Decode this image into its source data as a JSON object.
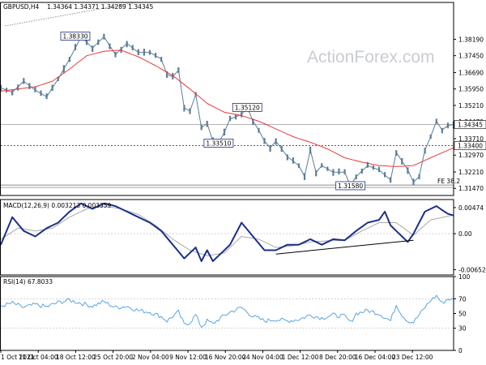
{
  "window": {
    "symbol_label": "GBPUSD,H4",
    "ohlc_label": "1.34364 1.34371 1.34289 1.34345",
    "watermark": "ActionForex.com"
  },
  "colors": {
    "price": "#5c7d96",
    "ma": "#e8393a",
    "macd": "#1c2f8c",
    "signal": "#a9a9a9",
    "rsi": "#4a9be0",
    "frame": "#000000",
    "grid": "#d9d9d9",
    "label_border": "#1c2f8c"
  },
  "chart_data": [
    {
      "type": "line",
      "panel": "price",
      "ylim": [
        1.3115,
        1.3985
      ],
      "y_ticks": [
        "1.38190",
        "1.37450",
        "1.36690",
        "1.35950",
        "1.35210",
        "1.34470",
        "1.33710",
        "1.32970",
        "1.32210",
        "1.31470"
      ],
      "y_tick_values": [
        1.3819,
        1.3745,
        1.3669,
        1.3595,
        1.3521,
        1.3447,
        1.3371,
        1.3297,
        1.3221,
        1.3147
      ],
      "current_price_label": "1.34345",
      "current_price": 1.34345,
      "level_label": "1.33400",
      "level": 1.334,
      "x_labels": [
        "1 Oct 2021",
        "11 Oct 04:00",
        "18 Oct 12:00",
        "25 Oct 20:00",
        "2 Nov 04:00",
        "9 Nov 12:00",
        "16 Nov 20:00",
        "24 Nov 04:00",
        "1 Dec 12:00",
        "8 Dec 20:00",
        "16 Dec 04:00",
        "23 Dec 12:00"
      ],
      "price_anchors": [
        [
          0,
          1.36
        ],
        [
          2,
          1.358
        ],
        [
          4,
          1.363
        ],
        [
          6,
          1.359
        ],
        [
          8,
          1.356
        ],
        [
          10,
          1.364
        ],
        [
          12,
          1.373
        ],
        [
          14,
          1.383
        ],
        [
          16,
          1.378
        ],
        [
          18,
          1.383
        ],
        [
          20,
          1.375
        ],
        [
          22,
          1.38
        ],
        [
          24,
          1.376
        ],
        [
          26,
          1.376
        ],
        [
          28,
          1.373
        ],
        [
          29,
          1.366
        ],
        [
          30,
          1.365
        ],
        [
          31,
          1.368
        ],
        [
          32,
          1.351
        ],
        [
          33,
          1.3495
        ],
        [
          34,
          1.357
        ],
        [
          35,
          1.342
        ],
        [
          36,
          1.344
        ],
        [
          37,
          1.336
        ],
        [
          38,
          1.3351
        ],
        [
          39,
          1.34
        ],
        [
          40,
          1.346
        ],
        [
          41,
          1.347
        ],
        [
          42,
          1.348
        ],
        [
          43,
          1.3512
        ],
        [
          44,
          1.345
        ],
        [
          45,
          1.341
        ],
        [
          46,
          1.336
        ],
        [
          47,
          1.333
        ],
        [
          48,
          1.336
        ],
        [
          50,
          1.329
        ],
        [
          52,
          1.325
        ],
        [
          53,
          1.32
        ],
        [
          54,
          1.332
        ],
        [
          55,
          1.3218
        ],
        [
          56,
          1.325
        ],
        [
          58,
          1.322
        ],
        [
          60,
          1.322
        ],
        [
          61,
          1.3159
        ],
        [
          62,
          1.32
        ],
        [
          64,
          1.325
        ],
        [
          66,
          1.323
        ],
        [
          68,
          1.3185
        ],
        [
          69,
          1.331
        ],
        [
          70,
          1.327
        ],
        [
          71,
          1.323
        ],
        [
          72,
          1.3175
        ],
        [
          73,
          1.32
        ],
        [
          74,
          1.332
        ],
        [
          75,
          1.338
        ],
        [
          76,
          1.345
        ],
        [
          77,
          1.341
        ],
        [
          78,
          1.343
        ],
        [
          79,
          1.3435
        ]
      ],
      "ma_anchors": [
        [
          0,
          1.3585
        ],
        [
          3,
          1.3595
        ],
        [
          6,
          1.3605
        ],
        [
          9,
          1.363
        ],
        [
          12,
          1.3685
        ],
        [
          15,
          1.3745
        ],
        [
          18,
          1.3765
        ],
        [
          21,
          1.377
        ],
        [
          24,
          1.374
        ],
        [
          27,
          1.37
        ],
        [
          30,
          1.3655
        ],
        [
          33,
          1.3595
        ],
        [
          36,
          1.353
        ],
        [
          39,
          1.349
        ],
        [
          42,
          1.3475
        ],
        [
          45,
          1.345
        ],
        [
          48,
          1.3415
        ],
        [
          51,
          1.338
        ],
        [
          54,
          1.3355
        ],
        [
          57,
          1.3325
        ],
        [
          60,
          1.3285
        ],
        [
          63,
          1.3265
        ],
        [
          66,
          1.325
        ],
        [
          69,
          1.3245
        ],
        [
          72,
          1.325
        ],
        [
          75,
          1.3285
        ],
        [
          79,
          1.333
        ]
      ],
      "annotations": [
        {
          "text": "1.38330",
          "price": 1.3833,
          "idx": 13
        },
        {
          "text": "1.35120",
          "price": 1.3512,
          "idx": 43
        },
        {
          "text": "1.33510",
          "price": 1.3351,
          "idx": 38
        },
        {
          "text": "1.31580",
          "price": 1.3159,
          "idx": 61
        }
      ],
      "fe_label": "FE 38.2",
      "fe_level": 1.3162
    },
    {
      "type": "line",
      "panel": "macd",
      "title": "MACD(12,26,9) 0.003213 0.003359",
      "ylim": [
        -0.0075,
        0.0062
      ],
      "y_ticks": [
        "0.00474",
        "0.00",
        "-0.006526"
      ],
      "y_tick_values": [
        0.00474,
        0.0,
        -0.006526
      ],
      "macd_anchors": [
        [
          0,
          -0.002
        ],
        [
          2,
          0.003
        ],
        [
          4,
          0.0005
        ],
        [
          6,
          -0.0005
        ],
        [
          8,
          0.001
        ],
        [
          10,
          0.002
        ],
        [
          12,
          0.004
        ],
        [
          14,
          0.0055
        ],
        [
          16,
          0.0045
        ],
        [
          18,
          0.0055
        ],
        [
          20,
          0.005
        ],
        [
          22,
          0.004
        ],
        [
          24,
          0.003
        ],
        [
          26,
          0.002
        ],
        [
          28,
          0.0005
        ],
        [
          30,
          -0.002
        ],
        [
          32,
          -0.0045
        ],
        [
          34,
          -0.0025
        ],
        [
          35,
          -0.005
        ],
        [
          36,
          -0.003
        ],
        [
          37,
          -0.005
        ],
        [
          38,
          -0.004
        ],
        [
          40,
          -0.002
        ],
        [
          42,
          0.002
        ],
        [
          44,
          -0.0005
        ],
        [
          46,
          -0.003
        ],
        [
          48,
          -0.003
        ],
        [
          50,
          -0.002
        ],
        [
          52,
          -0.002
        ],
        [
          54,
          -0.001
        ],
        [
          56,
          -0.002
        ],
        [
          58,
          -0.001
        ],
        [
          60,
          -0.0012
        ],
        [
          62,
          0.0005
        ],
        [
          64,
          0.002
        ],
        [
          66,
          0.0025
        ],
        [
          67,
          0.004
        ],
        [
          68,
          0.0015
        ],
        [
          70,
          -0.0005
        ],
        [
          71,
          -0.0015
        ],
        [
          72,
          0.0
        ],
        [
          74,
          0.004
        ],
        [
          76,
          0.005
        ],
        [
          78,
          0.0036
        ],
        [
          79,
          0.0033
        ]
      ],
      "signal_anchors": [
        [
          0,
          -0.001
        ],
        [
          3,
          0.001
        ],
        [
          6,
          0.0005
        ],
        [
          9,
          0.001
        ],
        [
          12,
          0.003
        ],
        [
          15,
          0.0045
        ],
        [
          18,
          0.005
        ],
        [
          21,
          0.0045
        ],
        [
          24,
          0.0035
        ],
        [
          27,
          0.0015
        ],
        [
          30,
          -0.001
        ],
        [
          33,
          -0.003
        ],
        [
          36,
          -0.004
        ],
        [
          39,
          -0.0035
        ],
        [
          42,
          -0.0005
        ],
        [
          45,
          -0.001
        ],
        [
          48,
          -0.0025
        ],
        [
          51,
          -0.0022
        ],
        [
          54,
          -0.0015
        ],
        [
          57,
          -0.0013
        ],
        [
          60,
          -0.0012
        ],
        [
          63,
          0.0005
        ],
        [
          66,
          0.002
        ],
        [
          69,
          0.002
        ],
        [
          72,
          -0.0003
        ],
        [
          75,
          0.0025
        ],
        [
          79,
          0.0034
        ]
      ],
      "trendline": [
        [
          48,
          -0.0037
        ],
        [
          72,
          -0.0012
        ]
      ]
    },
    {
      "type": "line",
      "panel": "rsi",
      "title": "RSI(14) 67.8033",
      "ylim": [
        0,
        100
      ],
      "y_ticks": [
        "100",
        "70",
        "50",
        "30",
        "0"
      ],
      "y_tick_values": [
        100,
        70,
        50,
        30,
        0
      ],
      "levels": [
        70,
        30
      ],
      "rsi_anchors": [
        [
          0,
          60
        ],
        [
          2,
          64
        ],
        [
          4,
          58
        ],
        [
          6,
          62
        ],
        [
          8,
          59
        ],
        [
          10,
          65
        ],
        [
          12,
          68
        ],
        [
          14,
          64
        ],
        [
          16,
          60
        ],
        [
          18,
          66
        ],
        [
          20,
          58
        ],
        [
          22,
          60
        ],
        [
          24,
          54
        ],
        [
          26,
          52
        ],
        [
          28,
          46
        ],
        [
          29,
          40
        ],
        [
          30,
          46
        ],
        [
          31,
          52
        ],
        [
          32,
          35
        ],
        [
          33,
          38
        ],
        [
          34,
          48
        ],
        [
          35,
          32
        ],
        [
          36,
          40
        ],
        [
          37,
          36
        ],
        [
          38,
          42
        ],
        [
          40,
          52
        ],
        [
          42,
          58
        ],
        [
          44,
          46
        ],
        [
          46,
          40
        ],
        [
          48,
          42
        ],
        [
          50,
          40
        ],
        [
          52,
          42
        ],
        [
          54,
          48
        ],
        [
          56,
          44
        ],
        [
          58,
          48
        ],
        [
          60,
          46
        ],
        [
          61,
          38
        ],
        [
          62,
          50
        ],
        [
          64,
          54
        ],
        [
          66,
          50
        ],
        [
          68,
          40
        ],
        [
          69,
          62
        ],
        [
          70,
          48
        ],
        [
          71,
          40
        ],
        [
          72,
          38
        ],
        [
          74,
          58
        ],
        [
          75,
          68
        ],
        [
          76,
          74
        ],
        [
          77,
          64
        ],
        [
          78,
          70
        ],
        [
          79,
          68
        ]
      ]
    }
  ]
}
